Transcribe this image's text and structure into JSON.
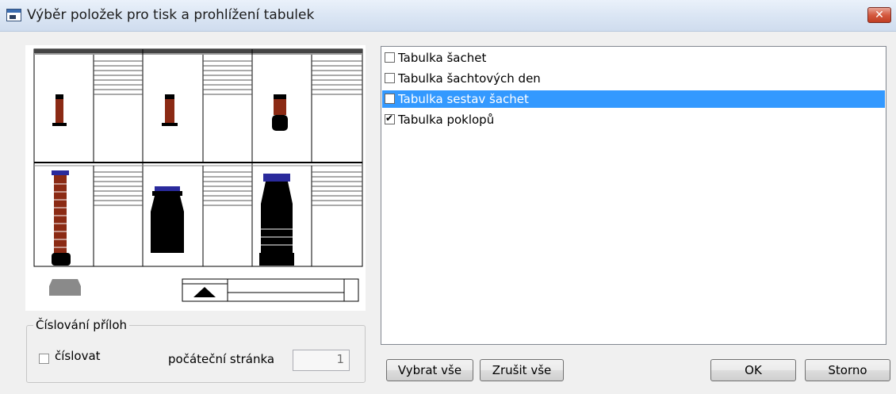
{
  "window": {
    "title": "Výběr položek pro tisk a prohlížení tabulek",
    "close_label": "✕"
  },
  "numbering": {
    "group_label": "Číslování příloh",
    "checkbox_label": "číslovat",
    "checkbox_checked": false,
    "start_page_label": "počáteční stránka",
    "start_page_value": "1"
  },
  "tables": {
    "items": [
      {
        "label": "Tabulka šachet",
        "checked": false,
        "selected": false
      },
      {
        "label": "Tabulka šachtových den",
        "checked": false,
        "selected": false
      },
      {
        "label": "Tabulka sestav šachet",
        "checked": false,
        "selected": true
      },
      {
        "label": "Tabulka poklopů",
        "checked": true,
        "selected": false
      }
    ]
  },
  "buttons": {
    "select_all": "Vybrat vše",
    "clear_all": "Zrušit vše",
    "ok": "OK",
    "cancel": "Storno"
  },
  "colors": {
    "selection": "#3399ff",
    "shaft_brown": "#8b2a14",
    "cover_blue": "#2a2a9c"
  }
}
